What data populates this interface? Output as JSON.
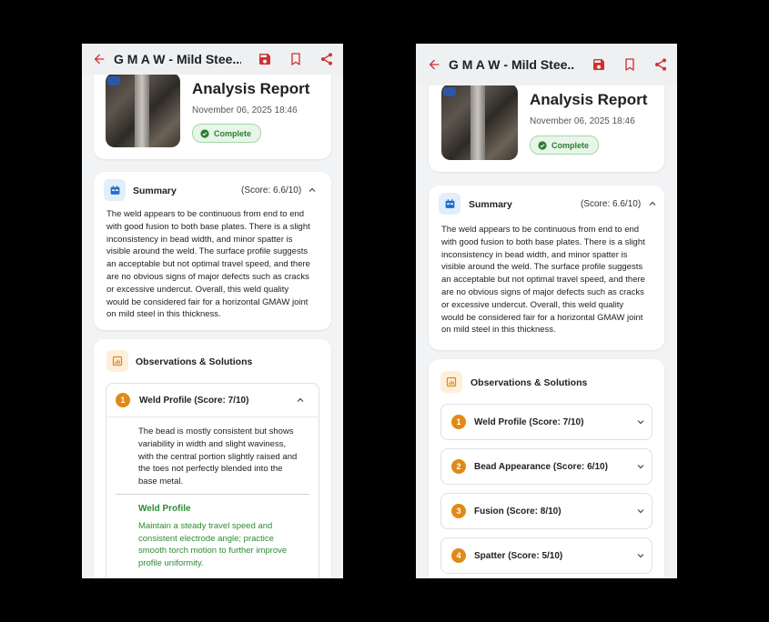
{
  "app_bar": {
    "title": "G M A W - Mild Stee..."
  },
  "report": {
    "title": "Analysis Report",
    "date": "November 06, 2025 18:46",
    "status": "Complete"
  },
  "summary": {
    "label": "Summary",
    "score": "(Score: 6.6/10)",
    "lines": [
      "The weld appears to be continuous from end to end",
      "with good fusion to both base plates. There is a slight",
      "inconsistency in bead width, and minor spatter is",
      "visible around the weld. The surface profile suggests",
      "an acceptable but not optimal travel speed, and there",
      "are no obvious signs of major defects such as cracks",
      "or excessive undercut. Overall, this weld quality",
      "would be considered fair for a horizontal GMAW joint",
      "on mild steel in this thickness."
    ]
  },
  "observations": {
    "label": "Observations & Solutions",
    "items": [
      {
        "num": "1",
        "label": "Weld Profile (Score: 7/10)"
      },
      {
        "num": "2",
        "label": "Bead Appearance (Score: 6/10)"
      },
      {
        "num": "3",
        "label": "Fusion (Score: 8/10)"
      },
      {
        "num": "4",
        "label": "Spatter (Score: 5/10)"
      }
    ],
    "expanded": {
      "description_lines": [
        "The bead is mostly consistent but shows",
        "variability in width and slight waviness,",
        "with the central portion slightly raised and",
        "the toes not perfectly blended into the",
        "base metal."
      ],
      "solution_title": "Weld Profile",
      "solution_lines": [
        "Maintain a steady travel speed and",
        "consistent electrode angle; practice",
        "smooth torch motion to further improve",
        "profile uniformity."
      ]
    }
  },
  "colors": {
    "accent": "#d32f2f",
    "status_green": "#2e7d32",
    "number_orange": "#e08a17"
  }
}
